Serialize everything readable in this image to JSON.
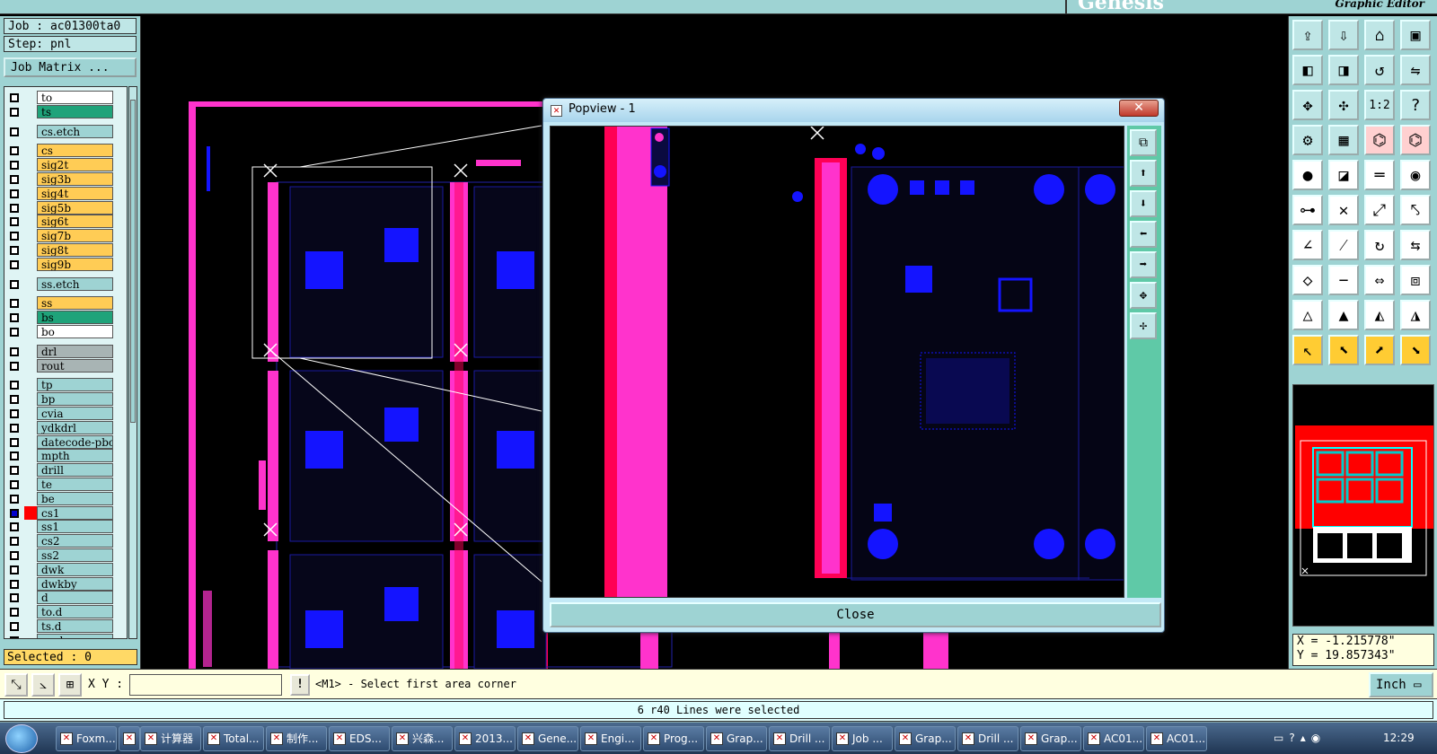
{
  "header": {
    "logo_subtitle": "Graphic Editor"
  },
  "left_panel": {
    "job_label": "Job : ac01300ta0",
    "step_label": "Step: pnl",
    "job_matrix_label": "Job Matrix ...",
    "selected_label": "Selected : 0",
    "layers": [
      {
        "name": "to",
        "color": "#ffffff",
        "active": false
      },
      {
        "name": "ts",
        "color": "#1fa37a",
        "active": false
      },
      {
        "name": "cs.etch",
        "color": "#9ed3d3",
        "active": false
      },
      {
        "name": "cs",
        "color": "#ffcc55",
        "active": false
      },
      {
        "name": "sig2t",
        "color": "#ffcc55",
        "active": false
      },
      {
        "name": "sig3b",
        "color": "#ffcc55",
        "active": false
      },
      {
        "name": "sig4t",
        "color": "#ffcc55",
        "active": false
      },
      {
        "name": "sig5b",
        "color": "#ffcc55",
        "active": false
      },
      {
        "name": "sig6t",
        "color": "#ffcc55",
        "active": false
      },
      {
        "name": "sig7b",
        "color": "#ffcc55",
        "active": false
      },
      {
        "name": "sig8t",
        "color": "#ffcc55",
        "active": false
      },
      {
        "name": "sig9b",
        "color": "#ffcc55",
        "active": false
      },
      {
        "name": "ss.etch",
        "color": "#9ed3d3",
        "active": false
      },
      {
        "name": "ss",
        "color": "#ffcc55",
        "active": false
      },
      {
        "name": "bs",
        "color": "#1fa37a",
        "active": false
      },
      {
        "name": "bo",
        "color": "#ffffff",
        "active": false
      },
      {
        "name": "drl",
        "color": "#a8b4b4",
        "active": false
      },
      {
        "name": "rout",
        "color": "#a8b4b4",
        "active": false
      },
      {
        "name": "tp",
        "color": "#9ed3d3",
        "active": false
      },
      {
        "name": "bp",
        "color": "#9ed3d3",
        "active": false
      },
      {
        "name": "cvia",
        "color": "#9ed3d3",
        "active": false
      },
      {
        "name": "ydkdrl",
        "color": "#9ed3d3",
        "active": false
      },
      {
        "name": "datecode-pbo",
        "color": "#9ed3d3",
        "active": false
      },
      {
        "name": "mpth",
        "color": "#9ed3d3",
        "active": false
      },
      {
        "name": "drill",
        "color": "#9ed3d3",
        "active": false
      },
      {
        "name": "te",
        "color": "#9ed3d3",
        "active": false
      },
      {
        "name": "be",
        "color": "#9ed3d3",
        "active": false
      },
      {
        "name": "cs1",
        "color": "#9ed3d3",
        "active": true
      },
      {
        "name": "ss1",
        "color": "#9ed3d3",
        "active": false
      },
      {
        "name": "cs2",
        "color": "#9ed3d3",
        "active": false
      },
      {
        "name": "ss2",
        "color": "#9ed3d3",
        "active": false
      },
      {
        "name": "dwk",
        "color": "#9ed3d3",
        "active": false
      },
      {
        "name": "dwkby",
        "color": "#9ed3d3",
        "active": false
      },
      {
        "name": "d",
        "color": "#9ed3d3",
        "active": false
      },
      {
        "name": "to.d",
        "color": "#9ed3d3",
        "active": false
      },
      {
        "name": "ts.d",
        "color": "#9ed3d3",
        "active": false
      },
      {
        "name": "cs.d",
        "color": "#9ed3d3",
        "active": false
      }
    ]
  },
  "popup": {
    "title": "Popview - 1",
    "close_x": "✕",
    "close_label": "Close"
  },
  "coords": {
    "x": "X = -1.215778\"",
    "y": "Y = 19.857343\""
  },
  "command_bar": {
    "xy_label": "X Y :",
    "xy_value": "",
    "prompt": "<M1> - Select first area corner",
    "unit_label": "Inch"
  },
  "status": "6 r40 Lines were selected",
  "taskbar": {
    "items": [
      "Foxm...",
      "",
      "计算器",
      "Total...",
      "制作...",
      "EDS...",
      "兴森...",
      "2013...",
      "Gene...",
      "Engi...",
      "Prog...",
      "Grap...",
      "Drill ...",
      "Job ...",
      "Grap...",
      "Drill ...",
      "Grap...",
      "AC01...",
      "AC01..."
    ],
    "clock": "12:29"
  }
}
